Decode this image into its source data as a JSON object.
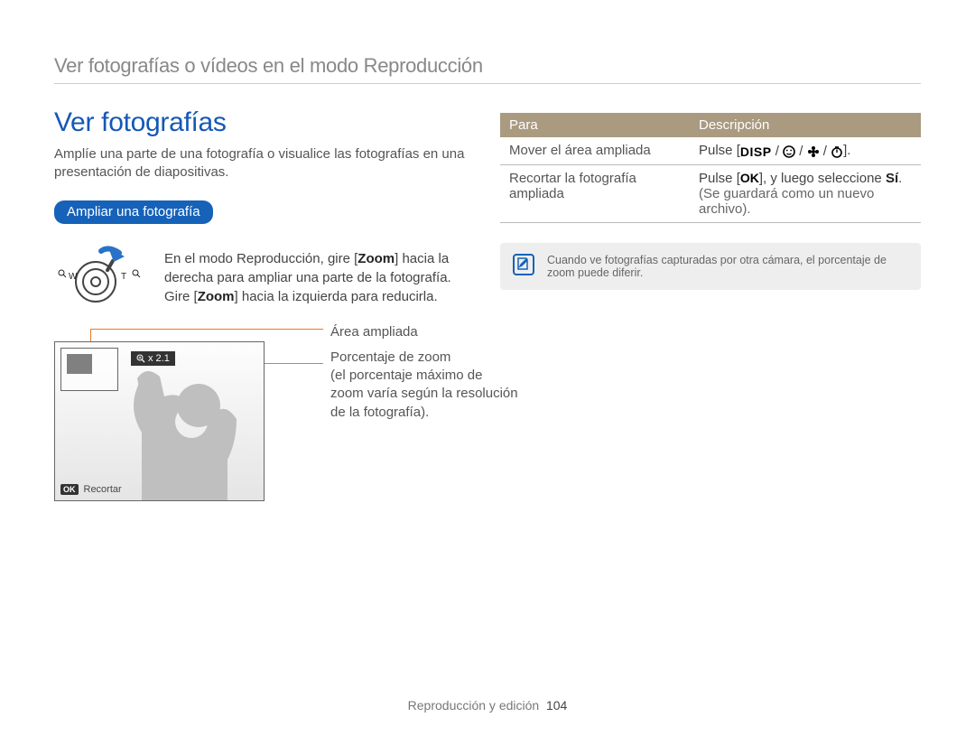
{
  "top_heading": "Ver fotografías o vídeos en el modo Reproducción",
  "section_title": "Ver fotografías",
  "intro": "Amplíe una parte de una fotografía o visualice las fotografías en una presentación de diapositivas.",
  "pill_label": "Ampliar una fotografía",
  "dial": {
    "w_label": "W",
    "t_label": "T",
    "text_pre": "En el modo Reproducción, gire [",
    "zoom1": "Zoom",
    "text_mid": "] hacia la derecha para ampliar una parte de la fotografía. Gire [",
    "zoom2": "Zoom",
    "text_post": "] hacia la izquierda para reducirla."
  },
  "diagram": {
    "zoom_indicator": "x 2.1",
    "recortar_label": "Recortar",
    "callout_area": "Área ampliada",
    "callout_zoom_l1": "Porcentaje de zoom",
    "callout_zoom_l2": "(el porcentaje máximo de",
    "callout_zoom_l3": "zoom varía según la resolución",
    "callout_zoom_l4": "de la fotografía)."
  },
  "table": {
    "head_para": "Para",
    "head_desc": "Descripción",
    "rows": [
      {
        "para": "Mover el área ampliada",
        "desc_pre": "Pulse [",
        "desc_post": "]."
      },
      {
        "para_l1": "Recortar la fotografía",
        "para_l2": "ampliada",
        "desc_pre": "Pulse [",
        "ok": "OK",
        "desc_mid": "], y luego seleccione ",
        "si": "Sí",
        "desc_post": ".",
        "sub": "(Se guardará como un nuevo archivo)."
      }
    ]
  },
  "note": "Cuando ve fotografías capturadas por otra cámara, el porcentaje de zoom puede diferir.",
  "footer_label": "Reproducción y edición",
  "footer_page": "104"
}
